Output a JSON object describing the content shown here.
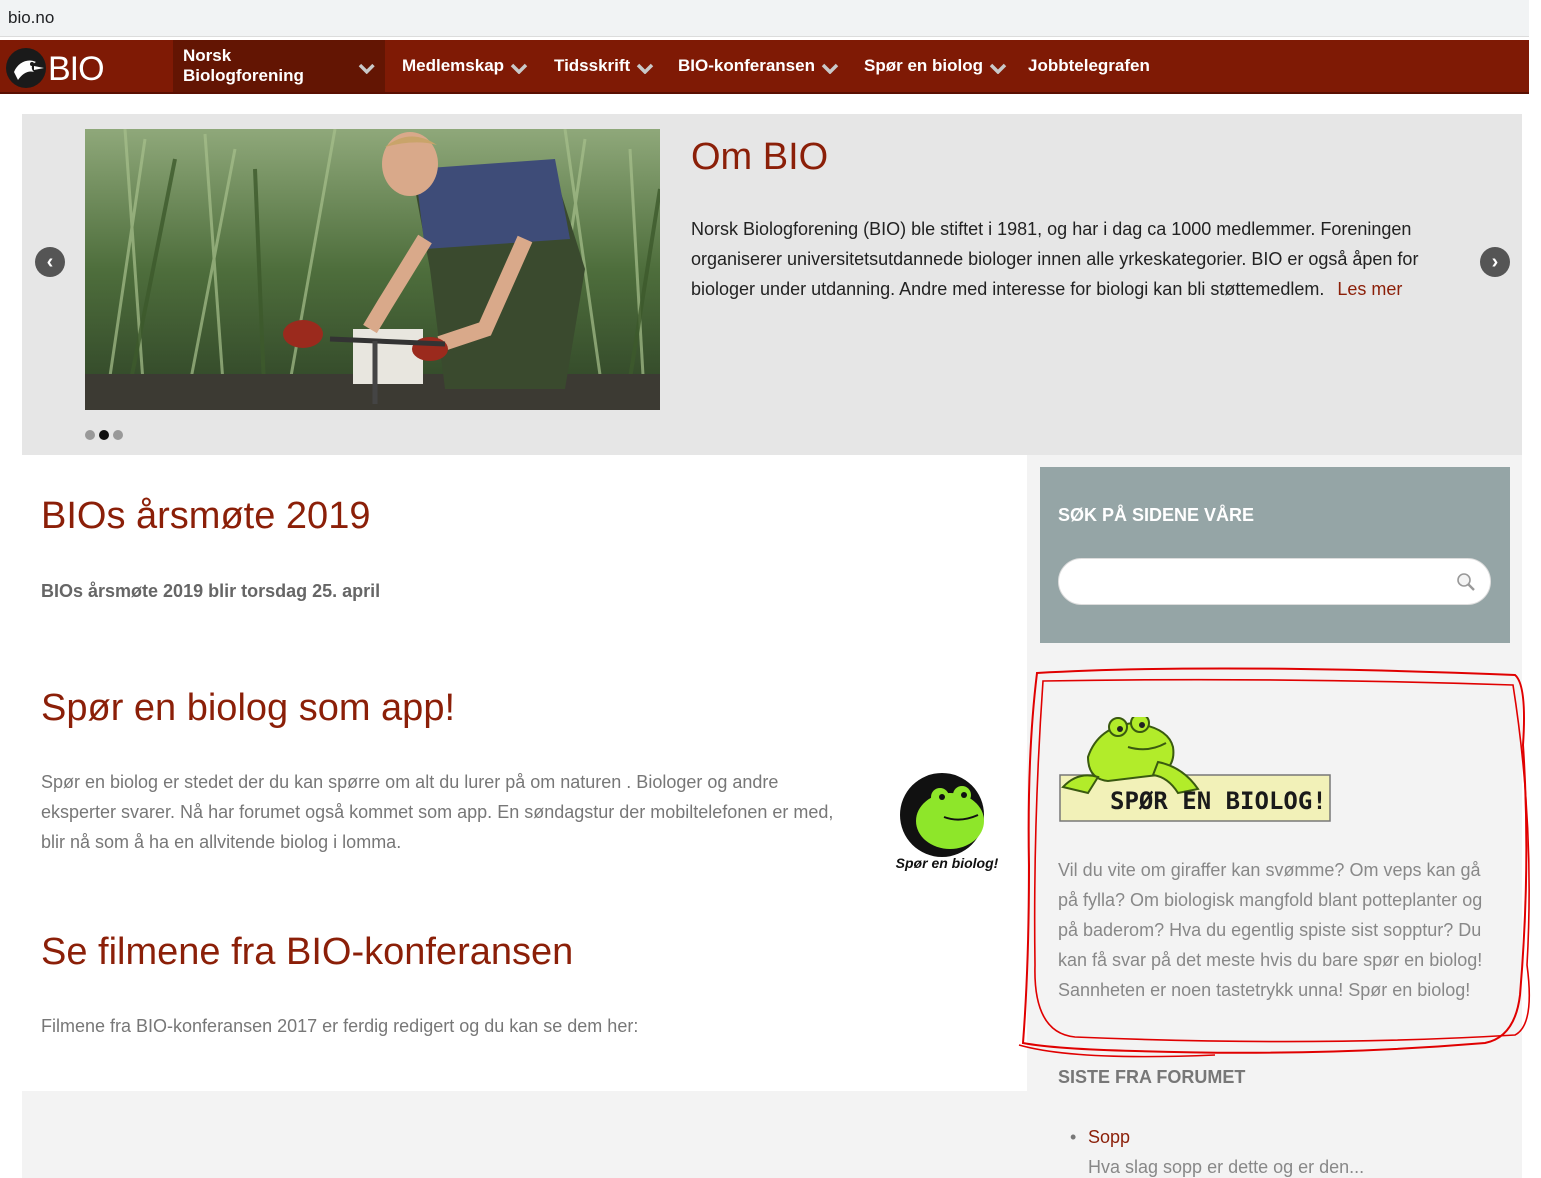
{
  "browser": {
    "url": "bio.no"
  },
  "nav": {
    "logo_text": "BIO",
    "items": [
      {
        "label": "Norsk Biologforening",
        "has_dropdown": true,
        "active": true
      },
      {
        "label": "Medlemskap",
        "has_dropdown": true
      },
      {
        "label": "Tidsskrift",
        "has_dropdown": true
      },
      {
        "label": "BIO-konferansen",
        "has_dropdown": true
      },
      {
        "label": "Spør en biolog",
        "has_dropdown": true
      },
      {
        "label": "Jobbtelegrafen",
        "has_dropdown": false
      }
    ]
  },
  "slider": {
    "title": "Om BIO",
    "text": "Norsk Biologforening (BIO) ble stiftet i 1981, og har i dag ca 1000 medlemmer. Foreningen organiserer universitetsutdannede biologer innen alle yrkeskategorier. BIO er også åpen for biologer under utdanning. Andre med interesse for biologi kan bli støttemedlem.",
    "read_more": "Les mer",
    "prev_icon": "‹",
    "next_icon": "›",
    "active_dot": 2,
    "dot_count": 3
  },
  "articles": [
    {
      "title": "BIOs årsmøte 2019",
      "text": "BIOs årsmøte 2019 blir torsdag 25. april"
    },
    {
      "title": "Spør en biolog som app!",
      "text": "Spør en biolog er stedet der du kan spørre om alt du lurer på om naturen . Biologer og andre eksperter svarer. Nå har forumet også kommet som app. En søndagstur der mobiltelefonen er med, blir nå som å ha en allvitende biolog i lomma.",
      "image_caption": "Spør en biolog!"
    },
    {
      "title": "Se filmene fra BIO-konferansen",
      "text": "Filmene fra BIO-konferansen 2017 er ferdig redigert og du kan se dem her:"
    }
  ],
  "sidebar": {
    "search_title": "SØK PÅ SIDENE VÅRE",
    "search_placeholder": "",
    "banner_text": "SPØR EN BIOLOG!",
    "widget_text": "Vil du vite om giraffer kan svømme? Om veps kan gå på fylla? Om biologisk mangfold blant potteplanter og på baderom? Hva du egentlig spiste sist sopptur? Du kan få svar på det meste hvis du bare spør en biolog! Sannheten er noen tastetrykk unna! Spør en biolog!",
    "forum_title": "SISTE FRA FORUMET",
    "forum_items": [
      {
        "title": "Sopp",
        "excerpt": "Hva slag sopp er dette og er den..."
      }
    ]
  },
  "colors": {
    "brand": "#7f1a05",
    "heading": "#8b1f08",
    "search_widget_bg": "#95a5a6",
    "annotation": "#e00000"
  }
}
